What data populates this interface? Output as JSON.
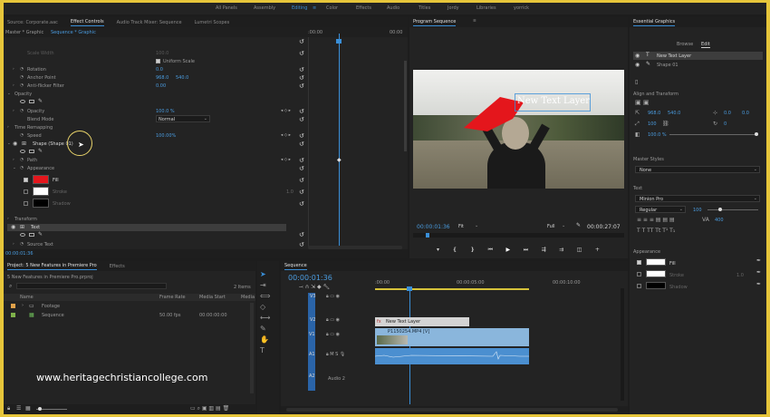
{
  "workspaces": [
    "All Panels",
    "Assembly",
    "Editing",
    "Color",
    "Effects",
    "Audio",
    "Titles",
    "Jordy",
    "Libraries",
    "yorrick"
  ],
  "workspace_active": "Editing",
  "effect_tabs": [
    "Source: Corporate.aac",
    "Effect Controls",
    "Audio Track Mixer: Sequence",
    "Lumetri Scopes"
  ],
  "ec": {
    "master": "Master * Graphic",
    "seq": "Sequence * Graphic",
    "tc_start": ":00:00",
    "tc_end": "00:00",
    "scale_width": "Scale Width",
    "scale_width_val": "100.0",
    "uniform_scale": "Uniform Scale",
    "rotation": "Rotation",
    "rotation_val": "0.0",
    "anchor": "Anchor Point",
    "anchor_x": "968.0",
    "anchor_y": "540.0",
    "antiflicker": "Anti-flicker Filter",
    "antiflicker_val": "0.00",
    "opacity_group": "Opacity",
    "opacity": "Opacity",
    "opacity_val": "100.0 %",
    "blend": "Blend Mode",
    "blend_val": "Normal",
    "time_remap": "Time Remapping",
    "speed": "Speed",
    "speed_val": "100.00%",
    "shape": "Shape (Shape 01)",
    "path": "Path",
    "appearance": "Appearance",
    "fill": "Fill",
    "stroke": "Stroke",
    "stroke_val": "1.0",
    "shadow": "Shadow",
    "transform": "Transform",
    "text": "Text",
    "source_text": "Source Text",
    "current_tc": "00:00:01:36"
  },
  "program": {
    "title": "Program Sequence",
    "overlay": "New Text Layer",
    "tc": "00:00:01:36",
    "fit": "Fit",
    "quality": "Full",
    "duration": "00:00:27:07"
  },
  "eg": {
    "title": "Essential Graphics",
    "tab_browse": "Browse",
    "tab_edit": "Edit",
    "layer1": "New Text Layer",
    "layer2": "Shape 01",
    "align": "Align and Transform",
    "pos_x": "968.0",
    "pos_y": "540.0",
    "anchor_x": "0.0",
    "anchor_y": "0.0",
    "scale": "100",
    "rot": "0",
    "opacity": "100.0 %",
    "master_styles": "Master Styles",
    "style_val": "None",
    "text_label": "Text",
    "font": "Minion Pro",
    "font_style": "Regular",
    "font_size": "100",
    "tracking": "400",
    "appearance": "Appearance",
    "fill": "Fill",
    "stroke": "Stroke",
    "stroke_val": "1.0",
    "shadow": "Shadow"
  },
  "project": {
    "tab": "Project: 5 New Features in Premiere Pro",
    "tab2": "Effects",
    "file": "5 New Features in Premiere Pro.prproj",
    "items": "2 Items",
    "cols": [
      "Name",
      "Frame Rate",
      "Media Start",
      "Media"
    ],
    "rows": [
      {
        "name": "Footage"
      },
      {
        "name": "Sequence",
        "rate": "50.00 fps",
        "start": "00:00:00:00"
      }
    ]
  },
  "timeline": {
    "tab": "Sequence",
    "tc": "00:00:01:36",
    "ruler": [
      ":00:00",
      "00:00:05:00",
      "00:00:10:00"
    ],
    "tracks": [
      "V3",
      "V2",
      "V1",
      "A1",
      "A2"
    ],
    "target": "V1",
    "audio2": "Audio 2",
    "clip_text": "New Text Layer",
    "clip_video": "P1150254.MP4 [V]"
  },
  "watermark": "www.heritagechristiancollege.com",
  "colors": {
    "accent": "#3a8fd8",
    "fill": "#e4161c",
    "frame": "#e6c53a"
  }
}
